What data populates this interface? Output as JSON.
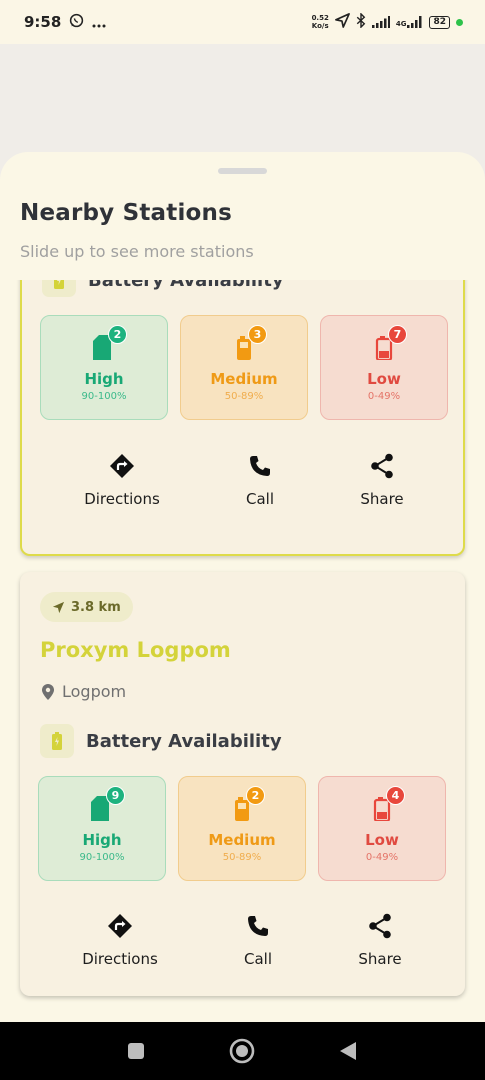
{
  "status_bar": {
    "time": "9:58",
    "net_speed_value": "0.52",
    "net_speed_unit": "Ko/s",
    "network_type": "4G",
    "battery_level": "82",
    "icons": [
      "whatsapp-icon",
      "more-icon",
      "location-arrow-icon",
      "bluetooth-icon",
      "signal-icon",
      "signal-4g-icon",
      "battery-icon"
    ]
  },
  "sheet": {
    "title": "Nearby Stations",
    "subtitle": "Slide up to see more stations"
  },
  "stations": [
    {
      "availability_title": "Battery Availability",
      "levels": [
        {
          "label": "High",
          "range": "90-100%",
          "count": "2"
        },
        {
          "label": "Medium",
          "range": "50-89%",
          "count": "3"
        },
        {
          "label": "Low",
          "range": "0-49%",
          "count": "7"
        }
      ],
      "actions": [
        {
          "label": "Directions",
          "icon": "directions-icon"
        },
        {
          "label": "Call",
          "icon": "phone-icon"
        },
        {
          "label": "Share",
          "icon": "share-icon"
        }
      ]
    },
    {
      "distance": "3.8 km",
      "name": "Proxym Logpom",
      "location": "Logpom",
      "availability_title": "Battery Availability",
      "levels": [
        {
          "label": "High",
          "range": "90-100%",
          "count": "9"
        },
        {
          "label": "Medium",
          "range": "50-89%",
          "count": "2"
        },
        {
          "label": "Low",
          "range": "0-49%",
          "count": "4"
        }
      ],
      "actions": [
        {
          "label": "Directions",
          "icon": "directions-icon"
        },
        {
          "label": "Call",
          "icon": "phone-icon"
        },
        {
          "label": "Share",
          "icon": "share-icon"
        }
      ]
    }
  ],
  "colors": {
    "accent": "#d4d33a",
    "high": "#18a875",
    "medium": "#ef9a16",
    "low": "#e04a40"
  },
  "nav_bar": {
    "buttons": [
      "recents-square-icon",
      "home-circle-icon",
      "back-triangle-icon"
    ]
  }
}
